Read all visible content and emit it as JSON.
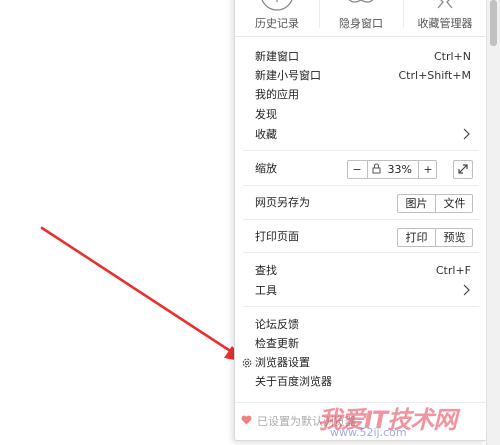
{
  "top_items": [
    {
      "label": "历史记录",
      "icon": "clock-icon"
    },
    {
      "label": "隐身窗口",
      "icon": "incognito-icon"
    },
    {
      "label": "收藏管理器",
      "icon": "star-icon"
    }
  ],
  "group1": [
    {
      "label": "新建窗口",
      "shortcut": "Ctrl+N"
    },
    {
      "label": "新建小号窗口",
      "shortcut": "Ctrl+Shift+M"
    },
    {
      "label": "我的应用",
      "shortcut": ""
    },
    {
      "label": "发现",
      "shortcut": ""
    },
    {
      "label": "收藏",
      "shortcut": ""
    }
  ],
  "zoom": {
    "label": "缩放",
    "minus": "−",
    "value": "33%",
    "plus": "+"
  },
  "save_page": {
    "label": "网页另存为",
    "btn1": "图片",
    "btn2": "文件"
  },
  "print_page": {
    "label": "打印页面",
    "btn1": "打印",
    "btn2": "预览"
  },
  "find": {
    "label": "查找",
    "shortcut": "Ctrl+F"
  },
  "tools": {
    "label": "工具"
  },
  "group4": {
    "feedback": "论坛反馈",
    "update": "检查更新",
    "settings": "浏览器设置",
    "about": "关于百度浏览器"
  },
  "footer_text": "已设置为默认浏览器",
  "watermark": "我爱IT技术网",
  "watermark_url": "www.52ij.com",
  "colors": {
    "arrow": "#e8312f",
    "heart": "#f08080"
  }
}
